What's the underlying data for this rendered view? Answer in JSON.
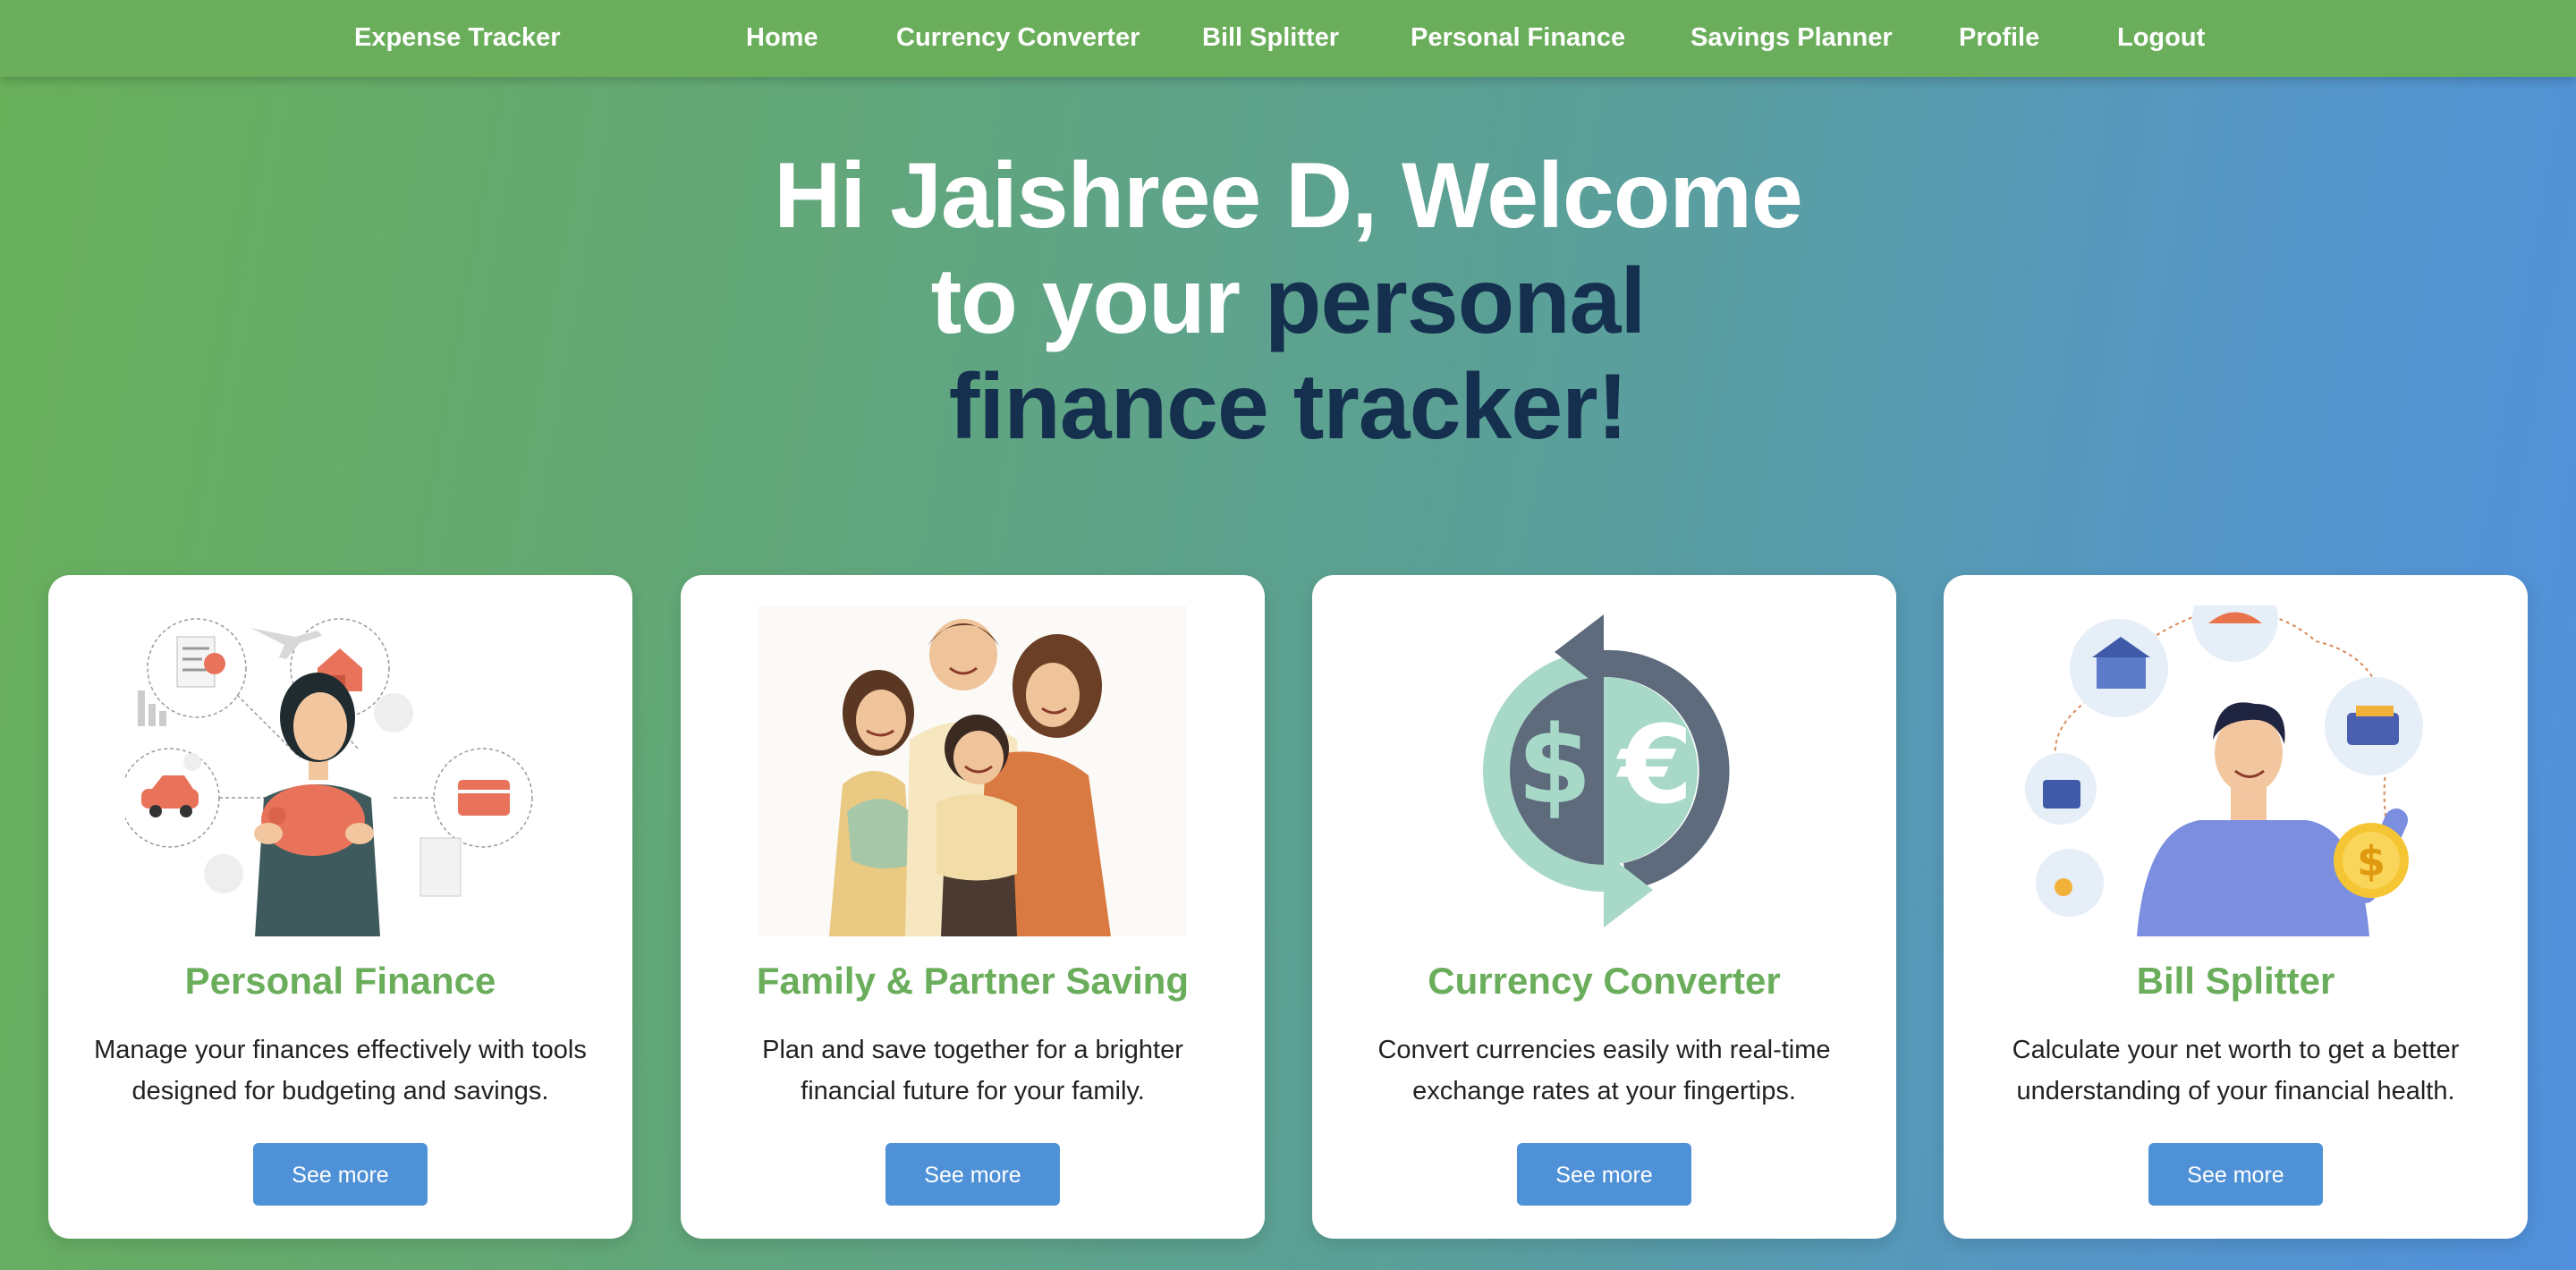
{
  "nav": {
    "brand": "Expense Tracker",
    "links": [
      "Home",
      "Currency Converter",
      "Bill Splitter",
      "Personal Finance",
      "Savings Planner",
      "Profile",
      "Logout"
    ]
  },
  "hero": {
    "line1": "Hi Jaishree D, Welcome",
    "line2_white": "to your",
    "line2_dark": "personal",
    "line3": "finance tracker!"
  },
  "cards": [
    {
      "title": "Personal Finance",
      "desc_line1": "Manage your finances effectively with tools",
      "desc_line2": "designed for budgeting and savings.",
      "button": "See more",
      "illustration": "woman-with-piggy-bank"
    },
    {
      "title": "Family & Partner Saving",
      "desc_line1": "Plan and save together for a brighter",
      "desc_line2": "financial future for your family.",
      "button": "See more",
      "illustration": "family-hugging"
    },
    {
      "title": "Currency Converter",
      "desc_line1": "Convert currencies easily with real-time",
      "desc_line2": "exchange rates at your fingertips.",
      "button": "See more",
      "illustration": "dollar-euro-exchange-icon"
    },
    {
      "title": "Bill Splitter",
      "desc_line1": "Calculate your net worth to get a better",
      "desc_line2": "understanding of your financial health.",
      "button": "See more",
      "illustration": "man-holding-coin"
    }
  ],
  "colors": {
    "nav_bg": "#6aae5b",
    "accent_green": "#6aae5b",
    "hero_dark": "#15304f",
    "button_blue": "#4f91d7",
    "gradient_start": "#69b05a",
    "gradient_end": "#5090dc"
  }
}
